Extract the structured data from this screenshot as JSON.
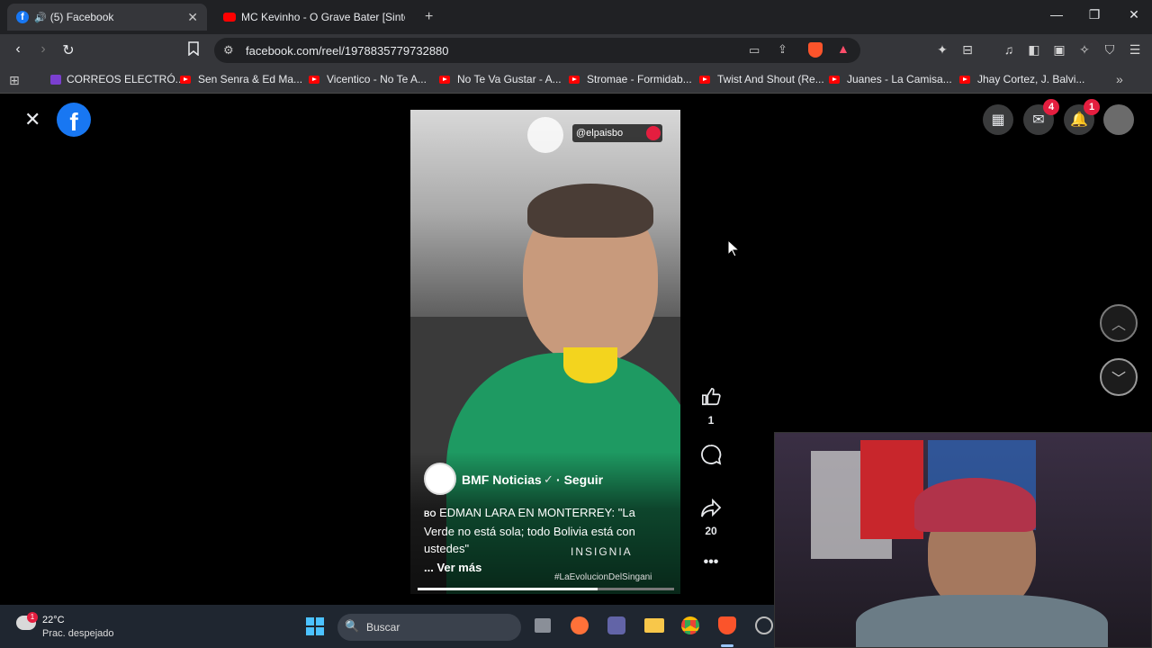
{
  "browser": {
    "tabs": [
      {
        "label": "(5) Facebook",
        "active": true
      },
      {
        "label": "MC Kevinho - O Grave Bater [Sintoni",
        "active": false
      }
    ],
    "new_tab": "+",
    "url": "facebook.com/reel/1978835779732880",
    "bookmarks": [
      {
        "label": "CORREOS ELECTRÓ...",
        "icon": "mail-icon"
      },
      {
        "label": "Sen Senra & Ed Ma...",
        "icon": "youtube-icon"
      },
      {
        "label": "Vicentico - No Te A...",
        "icon": "youtube-icon"
      },
      {
        "label": "No Te Va Gustar - A...",
        "icon": "youtube-icon"
      },
      {
        "label": "Stromae - Formidab...",
        "icon": "youtube-icon"
      },
      {
        "label": "Twist And Shout (Re...",
        "icon": "youtube-icon"
      },
      {
        "label": "Juanes - La Camisa...",
        "icon": "youtube-icon"
      },
      {
        "label": "Jhay Cortez, J. Balvi...",
        "icon": "youtube-icon"
      }
    ]
  },
  "facebook": {
    "messenger_badge": "4",
    "notifications_badge": "1",
    "reel": {
      "watermark": "@elpaisbo",
      "page_name": "BMF Noticias",
      "follow_label": "Seguir",
      "caption": "EDMAN LARA EN MONTERREY: \"La Verde no está sola; todo Bolivia está con ustedes\"",
      "caption_prefix": "BO",
      "see_more": "... Ver más",
      "brand_text": "INSIGNIA",
      "hashtag": "#LaEvolucionDelSingani",
      "progress": 0.7
    },
    "actions": {
      "likes": "1",
      "shares": "20"
    }
  },
  "taskbar": {
    "temperature": "22°C",
    "weather": "Prac. despejado",
    "weather_badge": "1",
    "search_placeholder": "Buscar"
  },
  "colors": {
    "facebook_blue": "#1877f2",
    "badge_red": "#e41e3f",
    "browser_dark": "#202124",
    "toolbar": "#35363a"
  }
}
